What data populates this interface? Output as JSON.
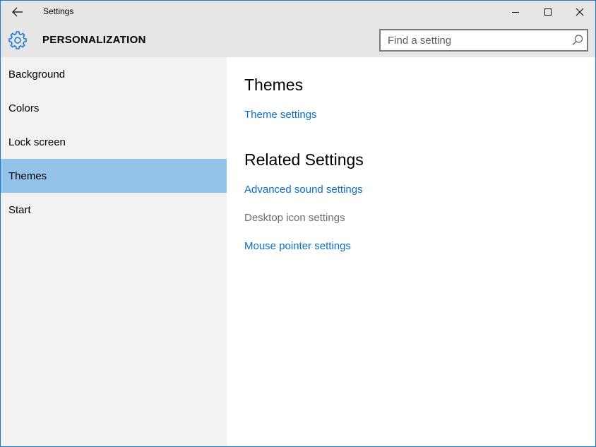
{
  "window": {
    "title": "Settings",
    "icons": {
      "back": "back-arrow-icon",
      "minimize": "minimize-icon",
      "maximize": "maximize-icon",
      "close": "close-icon"
    },
    "colors": {
      "border": "#1a77d2",
      "titlebar_bg": "#e6e6e6"
    }
  },
  "header": {
    "section": "PERSONALIZATION",
    "icon": "gear-icon",
    "gear_color": "#1a77d2",
    "search": {
      "placeholder": "Find a setting",
      "value": "",
      "icon": "search-icon"
    }
  },
  "sidebar": {
    "background": "#f2f2f2",
    "selected_color": "#94c3ea",
    "items": [
      {
        "label": "Background",
        "selected": false
      },
      {
        "label": "Colors",
        "selected": false
      },
      {
        "label": "Lock screen",
        "selected": false
      },
      {
        "label": "Themes",
        "selected": true
      },
      {
        "label": "Start",
        "selected": false
      }
    ]
  },
  "main": {
    "themes_heading": "Themes",
    "theme_settings_link": "Theme settings",
    "related_heading": "Related Settings",
    "related_links": [
      {
        "label": "Advanced sound settings",
        "enabled": true
      },
      {
        "label": "Desktop icon settings",
        "enabled": false
      },
      {
        "label": "Mouse pointer settings",
        "enabled": true
      }
    ],
    "link_color": "#0b6fc8",
    "disabled_color": "#6e6e6e"
  }
}
